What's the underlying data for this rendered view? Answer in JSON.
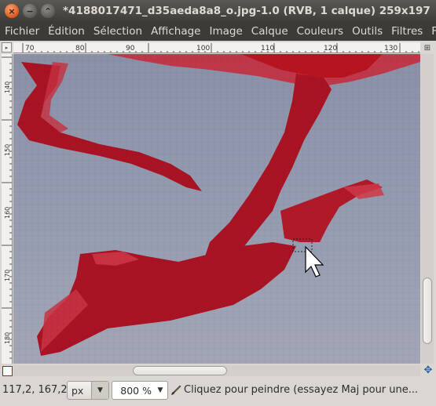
{
  "window": {
    "title": "*4188017471_d35aeda8a8_o.jpg-1.0 (RVB, 1 calque) 259x197",
    "close_glyph": "×",
    "minimize_glyph": "−",
    "maximize_glyph": "⌃"
  },
  "menubar": {
    "items": [
      "Fichier",
      "Édition",
      "Sélection",
      "Affichage",
      "Image",
      "Calque",
      "Couleurs",
      "Outils",
      "Filtres",
      "Fenê"
    ]
  },
  "rulers": {
    "horizontal_labels": [
      "70",
      "80",
      "90",
      "100",
      "110",
      "120",
      "130"
    ],
    "vertical_labels": [
      "140",
      "150",
      "160",
      "170",
      "180"
    ]
  },
  "canvas": {
    "painting_color": "#b2111d",
    "sky_color": "#8f97ad"
  },
  "status": {
    "coordinates": "117,2, 167,2",
    "unit": "px",
    "zoom": "800 %",
    "hint": "Cliquez pour peindre (essayez Maj pour une..."
  },
  "icons": {
    "nav": "navigate-icon",
    "quick_mask": "quick-mask-icon",
    "brush": "brush-icon",
    "menu_arrow": "menu-arrow-icon"
  }
}
